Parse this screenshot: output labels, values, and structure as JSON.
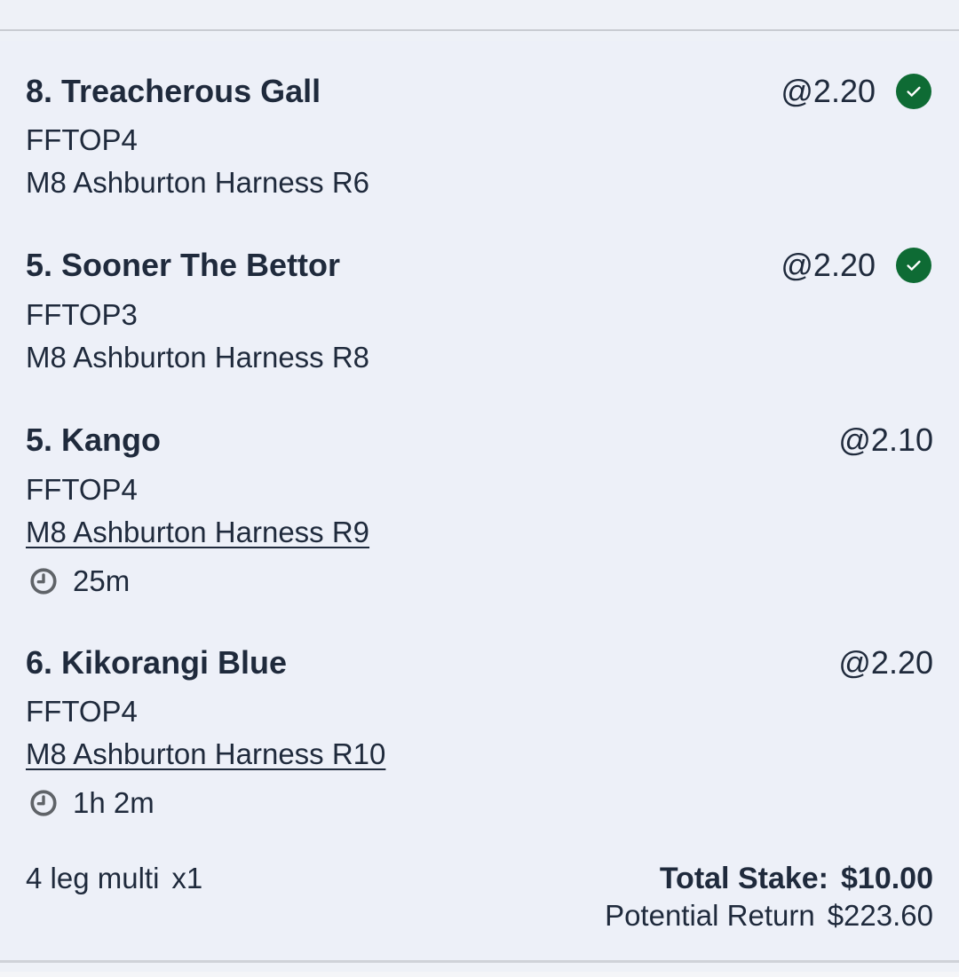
{
  "legs": [
    {
      "name": "8. Treacherous Gall",
      "odds": "@2.20",
      "bet_type": "FFTOP4",
      "race": "M8 Ashburton Harness R6",
      "settled": true,
      "time_to_start": ""
    },
    {
      "name": "5. Sooner The Bettor",
      "odds": "@2.20",
      "bet_type": "FFTOP3",
      "race": "M8 Ashburton Harness R8",
      "settled": true,
      "time_to_start": ""
    },
    {
      "name": "5. Kango",
      "odds": "@2.10",
      "bet_type": "FFTOP4",
      "race": "M8 Ashburton Harness R9",
      "settled": false,
      "time_to_start": "25m"
    },
    {
      "name": "6. Kikorangi Blue",
      "odds": "@2.20",
      "bet_type": "FFTOP4",
      "race": "M8 Ashburton Harness R10",
      "settled": false,
      "time_to_start": "1h 2m"
    }
  ],
  "summary": {
    "multi_label": "4 leg multi",
    "multiplier": "x1",
    "stake_label": "Total Stake:",
    "stake_value": "$10.00",
    "return_label": "Potential Return",
    "return_value": "$223.60"
  },
  "colors": {
    "background": "#edf0f8",
    "text": "#1f2a3c",
    "check_green": "#0e6b34",
    "clock_gray": "#5f6368"
  },
  "icons": {
    "check": "check-circle-icon",
    "clock": "clock-icon"
  }
}
